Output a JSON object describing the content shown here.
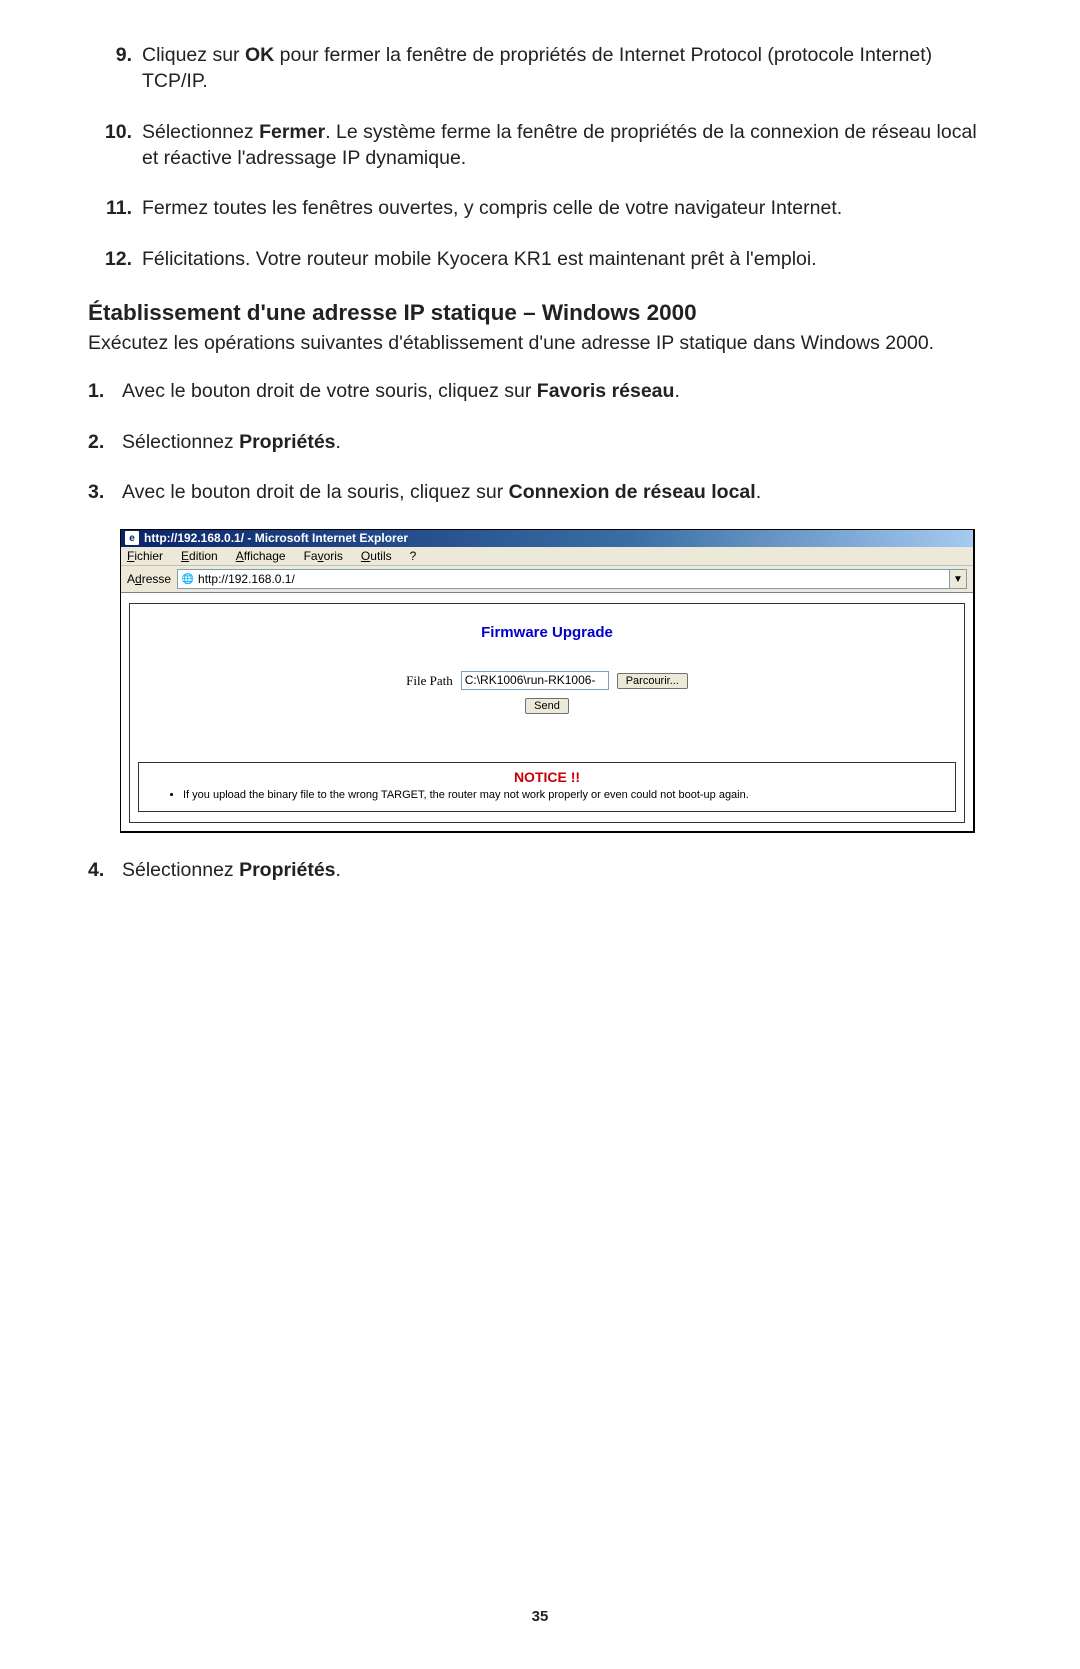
{
  "upper_steps": [
    {
      "num": "9.",
      "html": "Cliquez sur <b>OK</b> pour fermer la fenêtre de propriétés de Internet Protocol (protocole Internet) TCP/IP."
    },
    {
      "num": "10.",
      "html": "Sélectionnez <b>Fermer</b>. Le système ferme la fenêtre de propriétés de la connexion de réseau local et réactive l'adressage IP dynamique."
    },
    {
      "num": "11.",
      "html": "Fermez toutes les fenêtres ouvertes, y compris celle de votre navigateur Internet."
    },
    {
      "num": "12.",
      "html": "Félicitations. Votre routeur mobile Kyocera KR1 est maintenant prêt à l'emploi."
    }
  ],
  "heading": "Établissement d'une adresse IP statique – Windows 2000",
  "intro": "Exécutez les opérations suivantes d'établissement d'une adresse IP statique dans Windows 2000.",
  "lower_steps_a": [
    {
      "num": "1.",
      "html": "Avec le bouton droit de votre souris, cliquez sur <b>Favoris réseau</b>."
    },
    {
      "num": "2.",
      "html": "Sélectionnez <b>Propriétés</b>."
    },
    {
      "num": "3.",
      "html": "Avec le bouton droit de la souris, cliquez sur <b>Connexion de réseau local</b>."
    }
  ],
  "lower_steps_b": [
    {
      "num": "4.",
      "html": "Sélectionnez <b>Propriétés</b>."
    }
  ],
  "ie": {
    "title": "http://192.168.0.1/ - Microsoft Internet Explorer",
    "menu": {
      "fichier": "Fichier",
      "edition": "Edition",
      "affichage": "Affichage",
      "favoris": "Favoris",
      "outils": "Outils",
      "help": "?"
    },
    "adresse_label": "Adresse",
    "url": "http://192.168.0.1/",
    "dropdown_glyph": "▼",
    "firmware_title": "Firmware Upgrade",
    "file_label": "File Path",
    "file_value": "C:\\RK1006\\run-RK1006-",
    "browse_btn": "Parcourir...",
    "send_btn": "Send",
    "notice_title": "NOTICE !!",
    "notice_item": "If you upload the binary file to the wrong TARGET, the router may not work properly or even could not boot-up again."
  },
  "page_number": "35"
}
